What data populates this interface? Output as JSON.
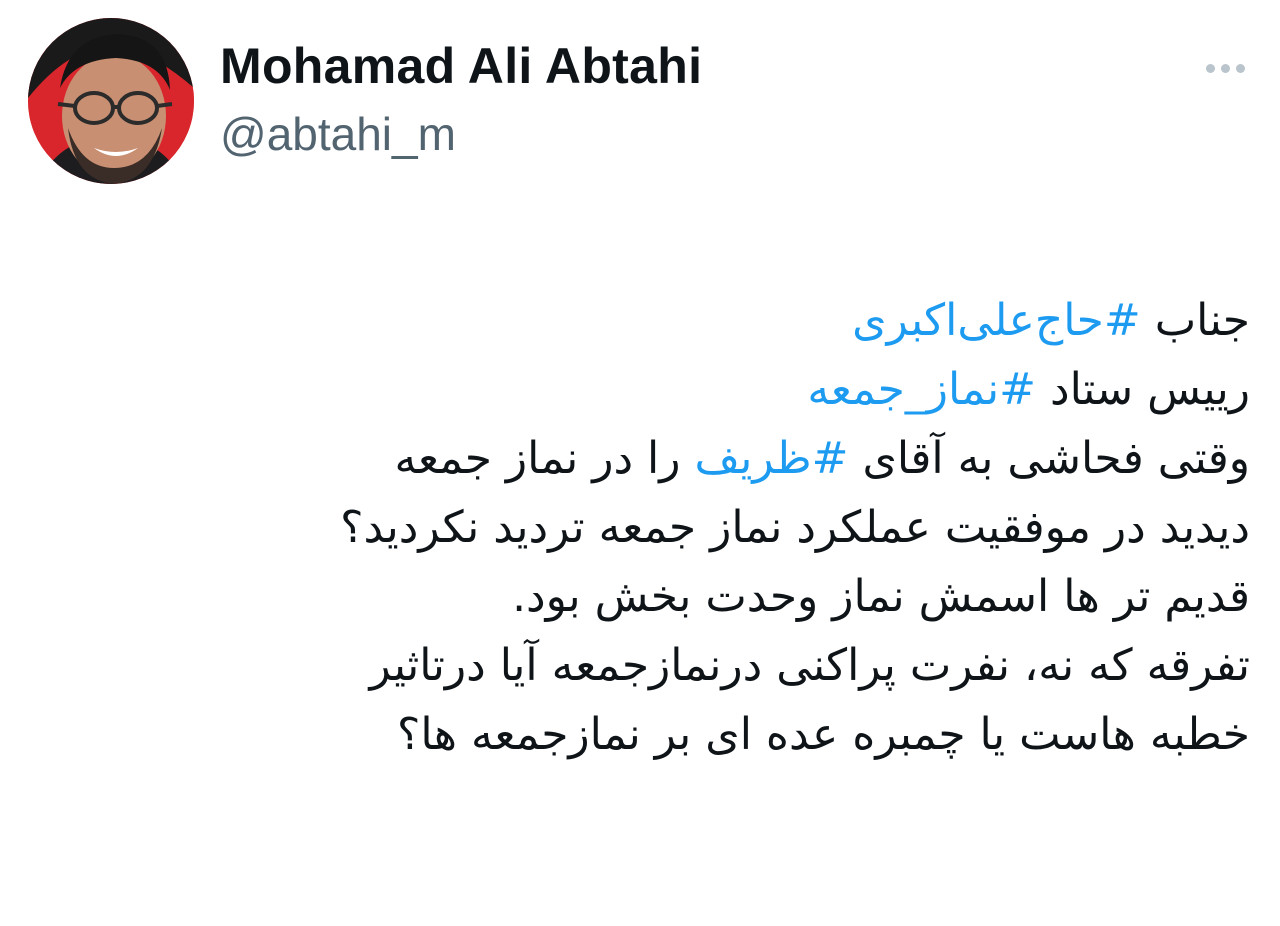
{
  "author": {
    "display_name": "Mohamad Ali Abtahi",
    "handle": "@abtahi_m",
    "avatar_icon": "profile-photo"
  },
  "more_icon": "more-dots-icon",
  "colors": {
    "hashtag": "#1d9bf0",
    "text": "#0f1419",
    "secondary": "#536471",
    "avatar_bg": "#e3342f"
  },
  "tweet": {
    "line1": {
      "text": "جناب ",
      "hashtag": "#حاج‌علی‌اکبری"
    },
    "line2": {
      "text": "رییس ستاد ",
      "hashtag": "#نماز_جمعه"
    },
    "line3": {
      "text_before": "وقتی فحاشی به آقای ",
      "hashtag": "#ظریف",
      "text_after": " را در نماز جمعه"
    },
    "line4": "دیدید در موفقیت عملکرد نماز جمعه تردید نکردید؟",
    "line5": "قدیم تر ها اسمش نماز وحدت بخش بود.",
    "line6": "تفرقه که نه، نفرت پراکنی درنمازجمعه آیا درتاثیر",
    "line7": "خطبه هاست یا چمبره عده ای بر نمازجمعه ها؟"
  }
}
